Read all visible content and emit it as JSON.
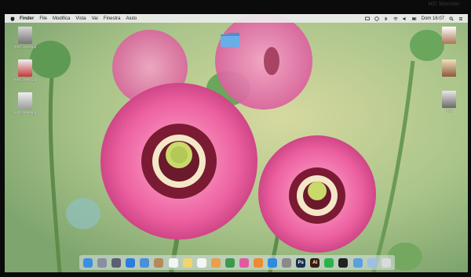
{
  "bezel": {
    "label": "HD Monitor"
  },
  "menubar": {
    "app": "Finder",
    "items": [
      "File",
      "Modifica",
      "Vista",
      "Vai",
      "Finestra",
      "Aiuto"
    ],
    "clock": "Dom 16:07"
  },
  "desktop": {
    "icons": [
      {
        "label": "IMG_1699.jpg"
      },
      {
        "label": "IMG_1698.jpg"
      },
      {
        "label": "IMG_1696.jpg"
      },
      {
        "label": "PNG"
      }
    ]
  },
  "dock": {
    "items": [
      {
        "name": "finder-icon",
        "color": "#3b8fe0"
      },
      {
        "name": "launchpad-icon",
        "color": "#8a8fa0"
      },
      {
        "name": "rocket-icon",
        "color": "#5a6070"
      },
      {
        "name": "safari-icon",
        "color": "#2a7de0"
      },
      {
        "name": "mail-icon",
        "color": "#4a90d9"
      },
      {
        "name": "contacts-icon",
        "color": "#b58a5a"
      },
      {
        "name": "calendar-icon",
        "color": "#f4f4f4"
      },
      {
        "name": "notes-icon",
        "color": "#f2d56b"
      },
      {
        "name": "reminders-icon",
        "color": "#f5f5f5"
      },
      {
        "name": "photos-icon",
        "color": "#e8a04a"
      },
      {
        "name": "facetime-icon",
        "color": "#3c9a4a"
      },
      {
        "name": "itunes-icon",
        "color": "#e05aa0"
      },
      {
        "name": "ibooks-icon",
        "color": "#f08a30"
      },
      {
        "name": "appstore-icon",
        "color": "#2f8be0"
      },
      {
        "name": "preferences-icon",
        "color": "#8a8a8a"
      },
      {
        "name": "photoshop-icon",
        "color": "#1a2f4a",
        "text": "Ps"
      },
      {
        "name": "illustrator-icon",
        "color": "#3a1a0a",
        "text": "Ai"
      },
      {
        "name": "whatsapp-icon",
        "color": "#2bb34a"
      },
      {
        "name": "terminal-icon",
        "color": "#222222"
      },
      {
        "name": "folder-icon",
        "color": "#5aa0e0"
      },
      {
        "name": "downloads-icon",
        "color": "#9ec0e0"
      },
      {
        "name": "trash-icon",
        "color": "#dadada"
      }
    ]
  }
}
